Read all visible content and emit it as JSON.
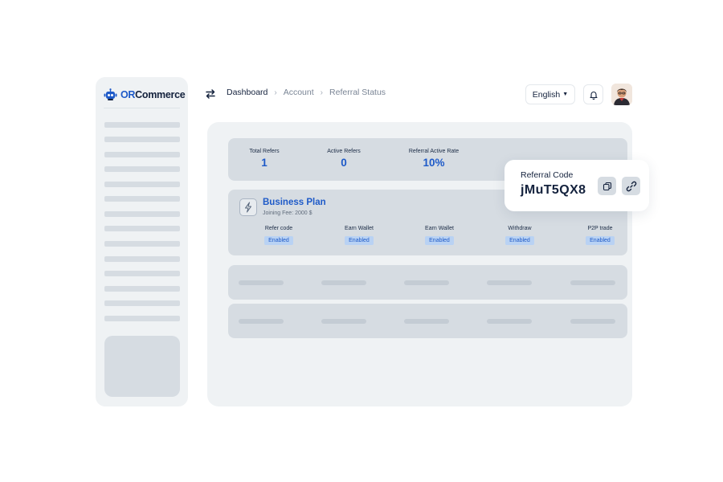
{
  "brand": {
    "name_prefix": "OR",
    "name_suffix": "Commerce"
  },
  "breadcrumb": [
    "Dashboard",
    "Account",
    "Referral Status"
  ],
  "header": {
    "language": "English"
  },
  "stats": [
    {
      "label": "Total Refers",
      "value": "1"
    },
    {
      "label": "Active Refers",
      "value": "0"
    },
    {
      "label": "Referral Active Rate",
      "value": "10%"
    }
  ],
  "plan": {
    "title": "Business Plan",
    "fee": "Joining Fee: 2000 $",
    "features": [
      {
        "label": "Refer code",
        "status": "Enabled"
      },
      {
        "label": "Earn Wallet",
        "status": "Enabled"
      },
      {
        "label": "Earn Wallet",
        "status": "Enabled"
      },
      {
        "label": "Withdraw",
        "status": "Enabled"
      },
      {
        "label": "P2P trade",
        "status": "Enabled"
      }
    ]
  },
  "referral": {
    "label": "Referral Code",
    "code": "jMuT5QX8"
  },
  "colors": {
    "accent": "#1e5ac8",
    "dark": "#14223d",
    "skeleton": "#d6dce2",
    "panel": "#eff2f4",
    "badge_bg": "#b9d2f3"
  },
  "icons": {
    "brand": "robot-logo-icon",
    "menu": "swap-arrows-icon",
    "notifications": "bell-icon",
    "plan": "lightning-icon",
    "copy": "copy-icon",
    "share": "link-icon"
  }
}
